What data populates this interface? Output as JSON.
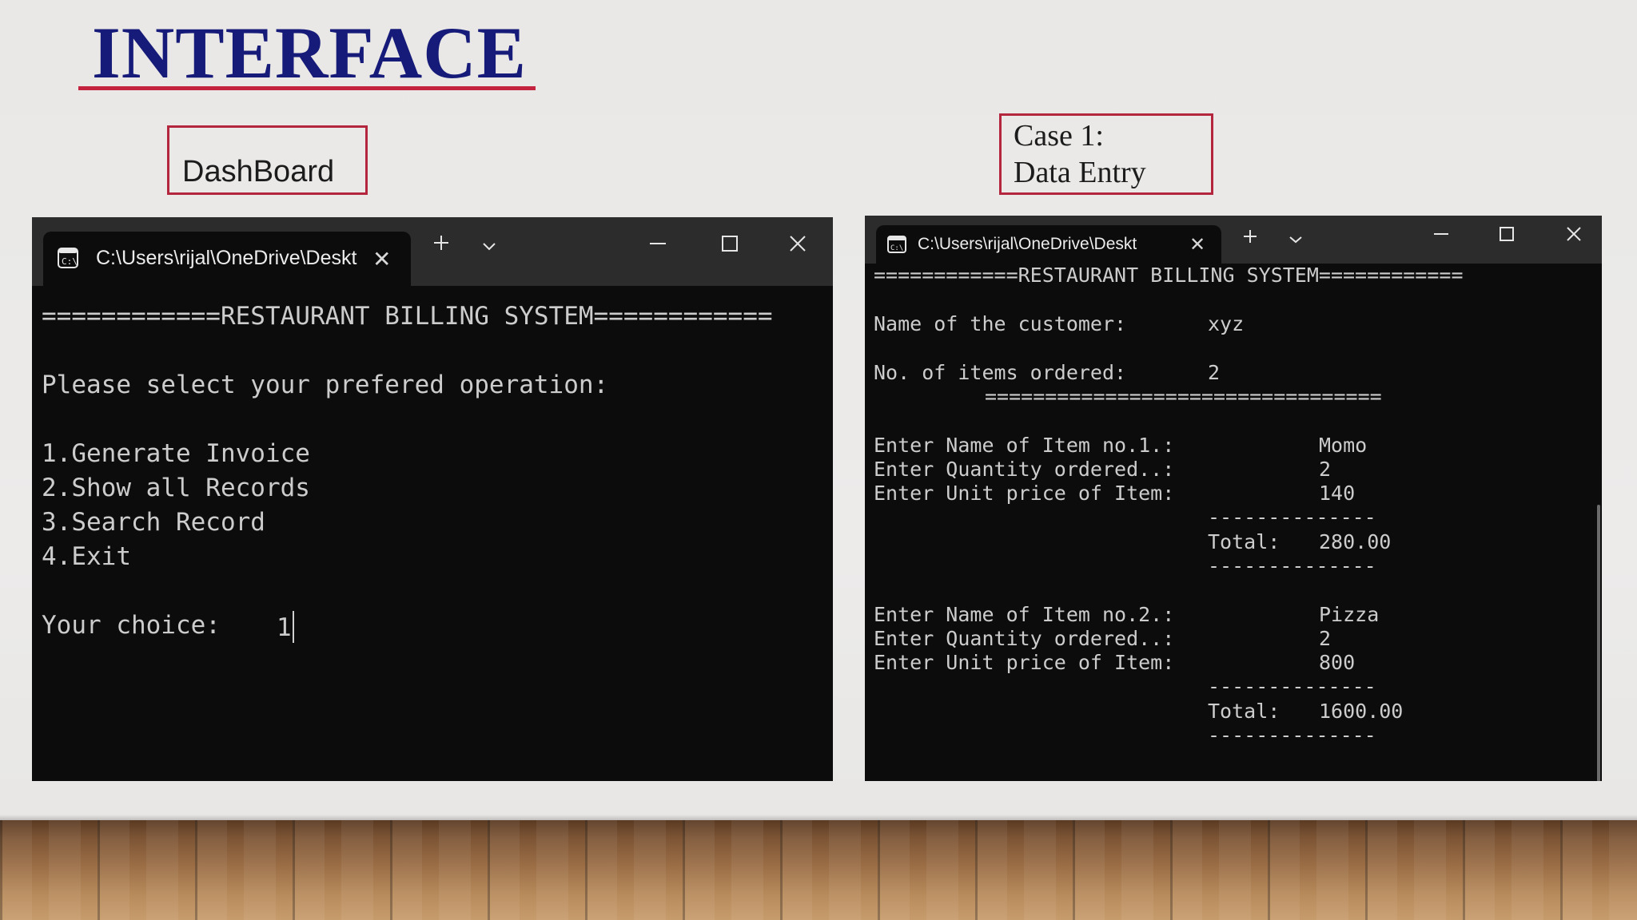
{
  "slide": {
    "title": "INTERFACE",
    "label_dashboard": "DashBoard",
    "label_case_line1": "Case 1:",
    "label_case_line2": "Data Entry"
  },
  "colors": {
    "title": "#161a78",
    "accent_red": "#c3233f",
    "terminal_bg": "#0c0c0c",
    "terminal_titlebar": "#2c2c2c",
    "terminal_text": "#cccccc"
  },
  "icons": {
    "tab": "terminal-icon",
    "tab_close": "close-icon",
    "new_tab": "plus-icon",
    "dropdown": "chevron-down-icon",
    "minimize": "minimize-icon",
    "maximize": "maximize-icon",
    "close": "close-icon"
  },
  "dashboard_terminal": {
    "tab_title": "C:\\Users\\rijal\\OneDrive\\Deskt",
    "header": "============RESTAURANT BILLING SYSTEM============",
    "prompt": "Please select your prefered operation:",
    "options": [
      "1.Generate Invoice",
      "2.Show all Records",
      "3.Search Record",
      "4.Exit"
    ],
    "choice_label": "Your choice:",
    "choice_value": "1"
  },
  "data_entry_terminal": {
    "tab_title": "C:\\Users\\rijal\\OneDrive\\Deskt",
    "header": "============RESTAURANT BILLING SYSTEM============",
    "customer_label": "Name of the customer:",
    "customer_value": "xyz",
    "items_label": "No. of items ordered:",
    "items_value": "2",
    "separator": "=================================",
    "item1_name_label": "Enter Name of Item no.1.:",
    "item1_name_value": "Momo",
    "item1_qty_label": "Enter Quantity ordered..:",
    "item1_qty_value": "2",
    "item1_price_label": "Enter Unit price of Item:",
    "item1_price_value": "140",
    "dash_line": "--------------",
    "item1_total_label": "Total:",
    "item1_total_value": "280.00",
    "item2_name_label": "Enter Name of Item no.2.:",
    "item2_name_value": "Pizza",
    "item2_qty_label": "Enter Quantity ordered..:",
    "item2_qty_value": "2",
    "item2_price_label": "Enter Unit price of Item:",
    "item2_price_value": "800",
    "item2_total_label": "Total:",
    "item2_total_value": "1600.00"
  }
}
